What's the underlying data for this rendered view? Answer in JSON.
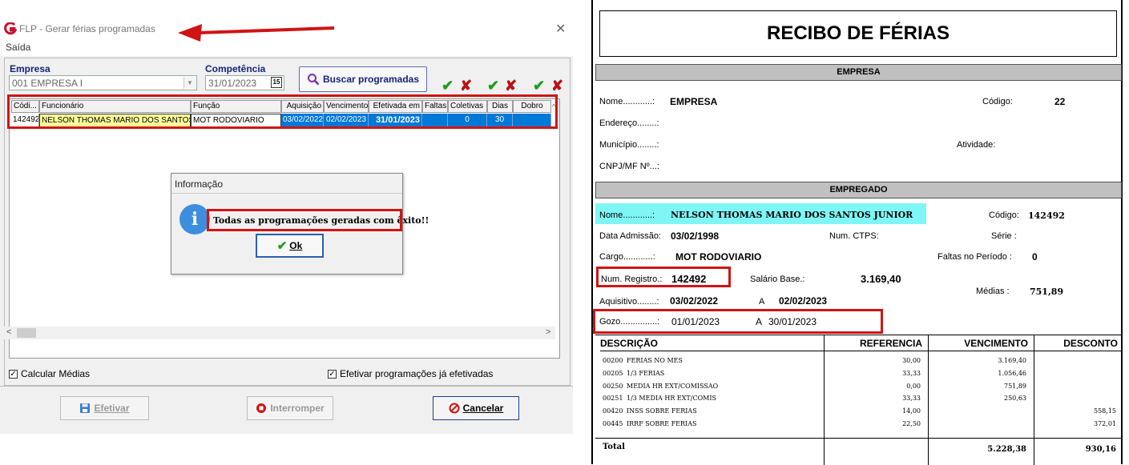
{
  "window": {
    "title": "FLP - Gerar férias programadas",
    "menu": "Saída"
  },
  "form": {
    "empresa_label": "Empresa",
    "empresa_value": "001 EMPRESA I",
    "competencia_label": "Competência",
    "competencia_value": "31/01/2023",
    "calendar_glyph": "15",
    "buscar_label": "Buscar programadas"
  },
  "grid": {
    "columns": [
      "Códi...",
      "Funcionário",
      "Função",
      "Aquisição",
      "Vencimento",
      "Efetivada em",
      "Faltas",
      "Coletivas",
      "Dias",
      "Dobro"
    ],
    "row": [
      "142492",
      "NELSON THOMAS MARIO DOS SANTOS",
      "MOT RODOVIARIO",
      "03/02/2022",
      "02/02/2023",
      "31/01/2023",
      "",
      "0",
      "30",
      ""
    ]
  },
  "options": {
    "calcular_medias": "Calcular Médias",
    "efetivar_programacoes": "Efetivar programações já efetivadas"
  },
  "buttons": {
    "efetivar": "Efetivar",
    "interromper": "Interromper",
    "cancelar": "Cancelar"
  },
  "dialog": {
    "title": "Informação",
    "message": "Todas as programações geradas com êxito!!",
    "ok": "Ok"
  },
  "receipt": {
    "title": "RECIBO DE FÉRIAS",
    "empresa_header": "EMPRESA",
    "nome_label": "Nome............:",
    "nome_value": "EMPRESA",
    "codigo_label": "Código:",
    "codigo_value": "22",
    "endereco_label": "Endereço........:",
    "municipio_label": "Município........:",
    "atividade_label": "Atividade:",
    "cnpj_label": "CNPJ/MF Nº...:",
    "empregado_header": "EMPREGADO",
    "emp_nome_label": "Nome............:",
    "emp_nome_value": "NELSON THOMAS MARIO DOS SANTOS JUNIOR",
    "emp_codigo_label": "Código:",
    "emp_codigo_value": "142492",
    "admissao_label": "Data Admissão:",
    "admissao_value": "03/02/1998",
    "ctps_label": "Num. CTPS:",
    "serie_label": "Série :",
    "cargo_label": "Cargo............:",
    "cargo_value": "MOT RODOVIARIO",
    "faltas_label": "Faltas no Período :",
    "faltas_value": "0",
    "registro_label": "Num. Registro.:",
    "registro_value": "142492",
    "salario_label": "Salário Base.:",
    "salario_value": "3.169,40",
    "medias_label": "Médias :",
    "medias_value": "751,89",
    "aquisitivo_label": "Aquisitivo........:",
    "aquisitivo_de": "03/02/2022",
    "aquisitivo_a_label": "A",
    "aquisitivo_ate": "02/02/2023",
    "gozo_label": "Gozo...............:",
    "gozo_de": "01/01/2023",
    "gozo_a_label": "A",
    "gozo_ate": "30/01/2023",
    "table_headers": [
      "DESCRIÇÃO",
      "REFERENCIA",
      "VENCIMENTO",
      "DESCONTO"
    ],
    "rows": [
      {
        "code": "00200",
        "desc": "FERIAS NO MES",
        "ref": "30,00",
        "venc": "3.169,40",
        "desc_val": ""
      },
      {
        "code": "00205",
        "desc": "1/3 FERIAS",
        "ref": "33,33",
        "venc": "1.056,46",
        "desc_val": ""
      },
      {
        "code": "00250",
        "desc": "MEDIA HR EXT/COMISSAO",
        "ref": "0,00",
        "venc": "751,89",
        "desc_val": ""
      },
      {
        "code": "00251",
        "desc": "1/3 MEDIA HR EXT/COMIS",
        "ref": "33,33",
        "venc": "250,63",
        "desc_val": ""
      },
      {
        "code": "00420",
        "desc": "INSS SOBRE FERIAS",
        "ref": "14,00",
        "venc": "",
        "desc_val": "558,15"
      },
      {
        "code": "00445",
        "desc": "IRRF SOBRE FERIAS",
        "ref": "22,50",
        "venc": "",
        "desc_val": "372,01"
      }
    ],
    "total_label": "Total",
    "total_venc": "5.228,38",
    "total_desc": "930,16"
  }
}
